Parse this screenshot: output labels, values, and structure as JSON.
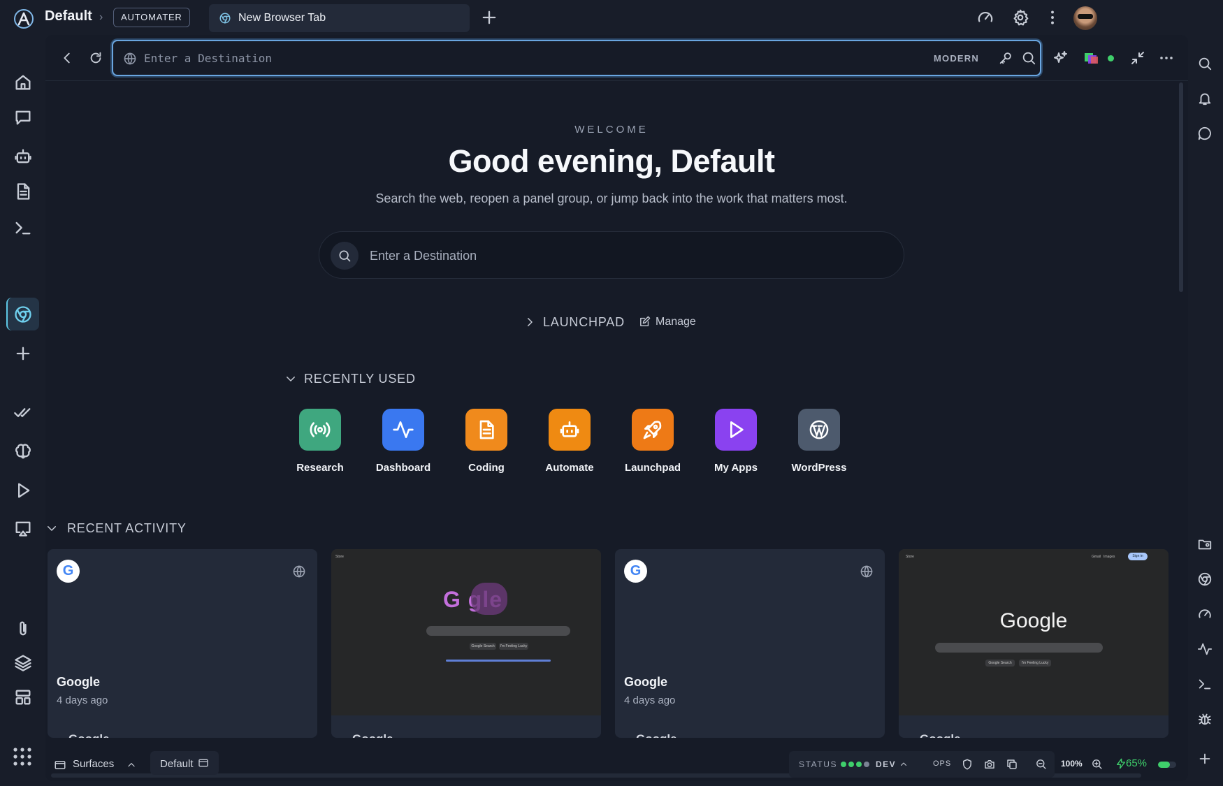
{
  "workspace": {
    "title": "Default",
    "badge": "AUTOMATER"
  },
  "tab": {
    "label": "New Browser Tab"
  },
  "urlbar": {
    "placeholder": "Enter a Destination",
    "mode": "MODERN"
  },
  "home": {
    "eyebrow": "WELCOME",
    "greeting": "Good evening, Default",
    "subtitle": "Search the web, reopen a panel group, or jump back into the work that matters most.",
    "search_placeholder": "Enter a Destination",
    "launchpad_label": "LAUNCHPAD",
    "manage_label": "Manage",
    "recently_used_label": "RECENTLY USED",
    "recent_activity_label": "RECENT ACTIVITY"
  },
  "apps": [
    {
      "label": "Research",
      "color": "#3fa77f",
      "icon": "broadcast-icon"
    },
    {
      "label": "Dashboard",
      "color": "#3a78f0",
      "icon": "pulse-icon"
    },
    {
      "label": "Coding",
      "color": "#f08a1c",
      "icon": "file-icon"
    },
    {
      "label": "Automate",
      "color": "#ef8a12",
      "icon": "robot-icon"
    },
    {
      "label": "Launchpad",
      "color": "#ee7a16",
      "icon": "rocket-icon"
    },
    {
      "label": "My Apps",
      "color": "#8a42f0",
      "icon": "play-icon"
    },
    {
      "label": "WordPress",
      "color": "#4d5a6d",
      "icon": "wordpress-icon"
    }
  ],
  "activity": [
    {
      "title": "Google",
      "time": "4 days ago",
      "next": "Google"
    },
    {
      "title": "",
      "time": "",
      "next": "Google",
      "shot_logo": "G  gle"
    },
    {
      "title": "Google",
      "time": "4 days ago",
      "next": "Google"
    },
    {
      "title": "",
      "time": "",
      "next": "Google",
      "shot_logo": "Google"
    }
  ],
  "screenshot_text": {
    "search_btn": "Google Search",
    "lucky_btn": "I'm Feeling Lucky",
    "ai_mode": "AI Mode",
    "sign_in": "Sign in",
    "gmail": "Gmail",
    "images": "Images",
    "store": "Store"
  },
  "bottom": {
    "surfaces_label": "Surfaces",
    "default_label": "Default",
    "status_label": "STATUS",
    "env_label": "DEV",
    "ops_label": "OPS",
    "zoom": "100%",
    "battery": "65%",
    "battery_level": 0.65
  },
  "colors": {
    "accent": "#5ec8e6",
    "ok": "#3fcf6b",
    "focus_ring": "#6aa6e0"
  }
}
